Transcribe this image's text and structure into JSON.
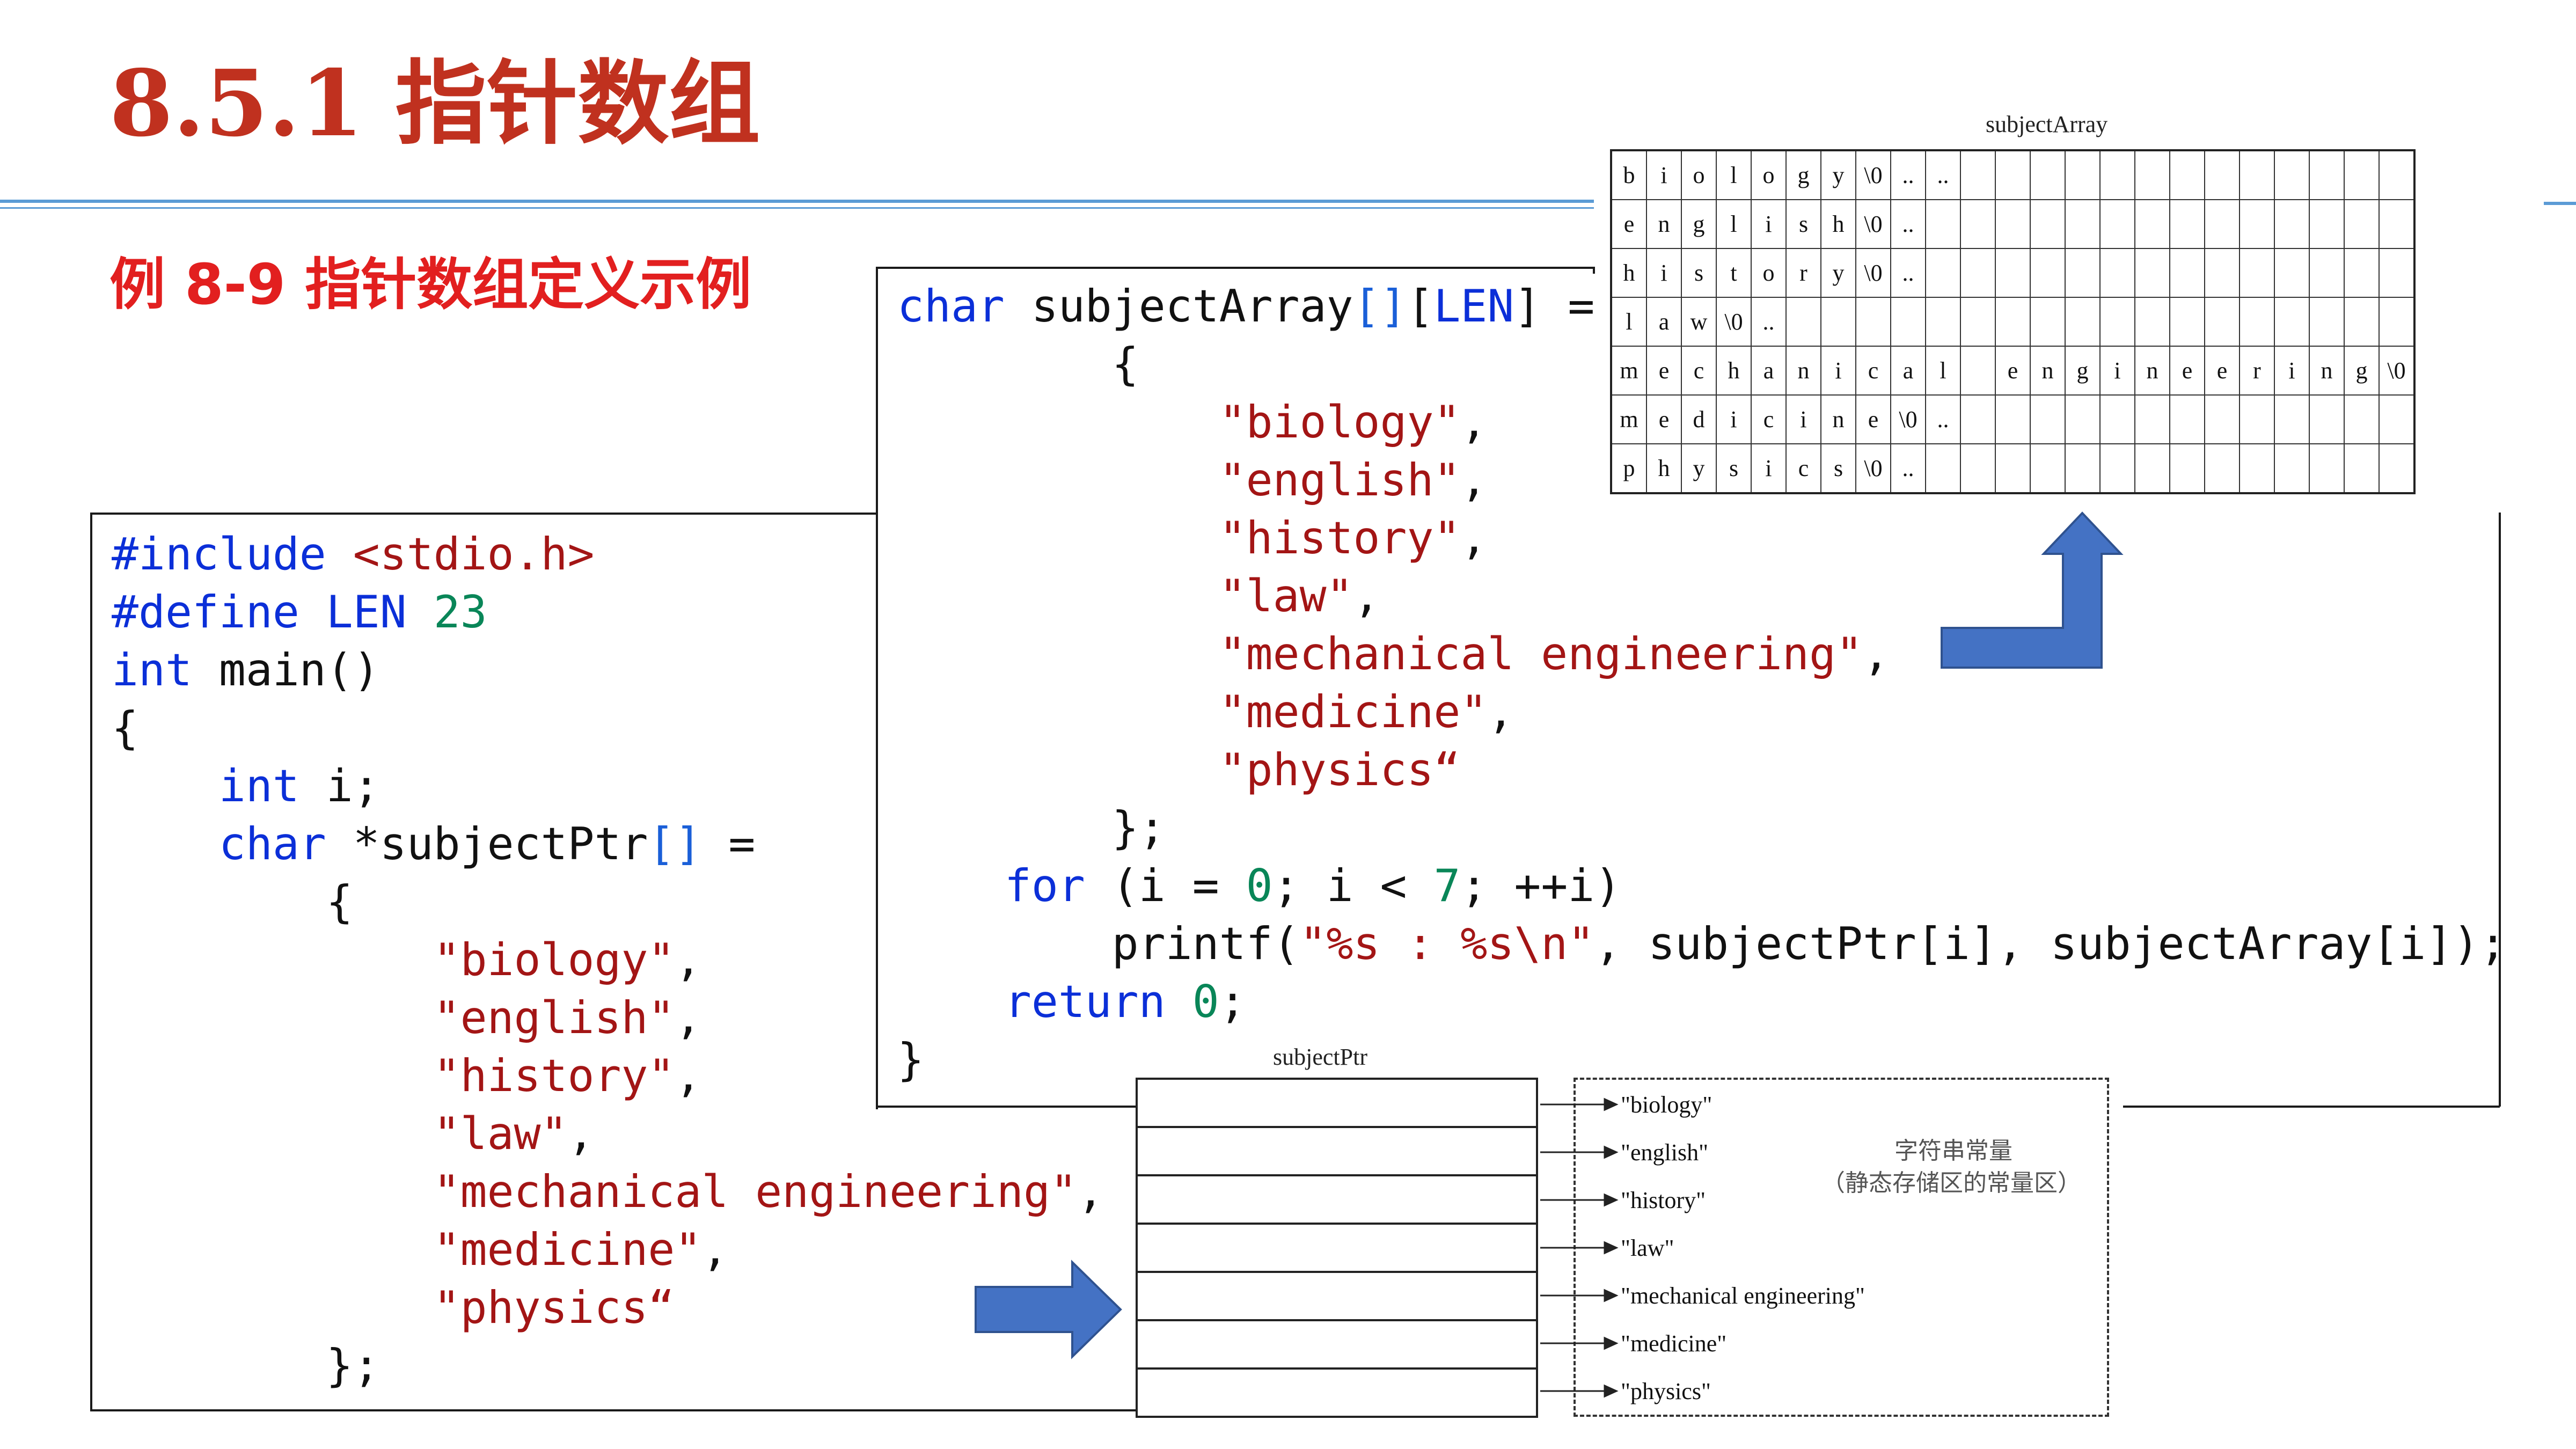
{
  "title": "8.5.1 指针数组",
  "subtitle": "例 8-9 指针数组定义示例",
  "code_left": [
    [
      {
        "t": "#include",
        "c": "kw"
      },
      {
        "t": " "
      },
      {
        "t": "<stdio.h>",
        "c": "str"
      }
    ],
    [
      {
        "t": "#define",
        "c": "kw"
      },
      {
        "t": " "
      },
      {
        "t": "LEN",
        "c": "kw"
      },
      {
        "t": " "
      },
      {
        "t": "23",
        "c": "num"
      }
    ],
    [
      {
        "t": "int",
        "c": "kw"
      },
      {
        "t": " main()"
      }
    ],
    [
      {
        "t": "{"
      }
    ],
    [
      {
        "t": "    "
      },
      {
        "t": "int",
        "c": "kw"
      },
      {
        "t": " i;"
      }
    ],
    [
      {
        "t": "    "
      },
      {
        "t": "char",
        "c": "kw"
      },
      {
        "t": " *subjectPtr"
      },
      {
        "t": "[]",
        "c": "br"
      },
      {
        "t": " ="
      }
    ],
    [
      {
        "t": "        {"
      }
    ],
    [
      {
        "t": "            "
      },
      {
        "t": "\"biology\"",
        "c": "str"
      },
      {
        "t": ","
      }
    ],
    [
      {
        "t": "            "
      },
      {
        "t": "\"english\"",
        "c": "str"
      },
      {
        "t": ","
      }
    ],
    [
      {
        "t": "            "
      },
      {
        "t": "\"history\"",
        "c": "str"
      },
      {
        "t": ","
      }
    ],
    [
      {
        "t": "            "
      },
      {
        "t": "\"law\"",
        "c": "str"
      },
      {
        "t": ","
      }
    ],
    [
      {
        "t": "            "
      },
      {
        "t": "\"mechanical engineering\"",
        "c": "str"
      },
      {
        "t": ","
      }
    ],
    [
      {
        "t": "            "
      },
      {
        "t": "\"medicine\"",
        "c": "str"
      },
      {
        "t": ","
      }
    ],
    [
      {
        "t": "            "
      },
      {
        "t": "\"physics“",
        "c": "str"
      }
    ],
    [
      {
        "t": "        };"
      }
    ]
  ],
  "code_right": [
    [
      {
        "t": "char",
        "c": "kw"
      },
      {
        "t": " subjectArray"
      },
      {
        "t": "[]",
        "c": "br"
      },
      {
        "t": "["
      },
      {
        "t": "LEN",
        "c": "kw"
      },
      {
        "t": "] ="
      }
    ],
    [
      {
        "t": "        {"
      }
    ],
    [
      {
        "t": "            "
      },
      {
        "t": "\"biology\"",
        "c": "str"
      },
      {
        "t": ","
      }
    ],
    [
      {
        "t": "            "
      },
      {
        "t": "\"english\"",
        "c": "str"
      },
      {
        "t": ","
      }
    ],
    [
      {
        "t": "            "
      },
      {
        "t": "\"history\"",
        "c": "str"
      },
      {
        "t": ","
      }
    ],
    [
      {
        "t": "            "
      },
      {
        "t": "\"law\"",
        "c": "str"
      },
      {
        "t": ","
      }
    ],
    [
      {
        "t": "            "
      },
      {
        "t": "\"mechanical engineering\"",
        "c": "str"
      },
      {
        "t": ","
      }
    ],
    [
      {
        "t": "            "
      },
      {
        "t": "\"medicine\"",
        "c": "str"
      },
      {
        "t": ","
      }
    ],
    [
      {
        "t": "            "
      },
      {
        "t": "\"physics“",
        "c": "str"
      }
    ],
    [
      {
        "t": "        };"
      }
    ],
    [
      {
        "t": "    "
      },
      {
        "t": "for",
        "c": "kw"
      },
      {
        "t": " (i = "
      },
      {
        "t": "0",
        "c": "num"
      },
      {
        "t": "; i < "
      },
      {
        "t": "7",
        "c": "num"
      },
      {
        "t": "; ++i)"
      }
    ],
    [
      {
        "t": "        printf("
      },
      {
        "t": "\"%s : %s\\n\"",
        "c": "str"
      },
      {
        "t": ", subjectPtr[i], subjectArray[i]);"
      }
    ],
    [
      {
        "t": "    "
      },
      {
        "t": "return",
        "c": "kw"
      },
      {
        "t": " "
      },
      {
        "t": "0",
        "c": "num"
      },
      {
        "t": ";"
      }
    ],
    [
      {
        "t": "}"
      }
    ]
  ],
  "subjectArray_figure": {
    "label": "subjectArray",
    "rows": [
      [
        "b",
        "i",
        "o",
        "l",
        "o",
        "g",
        "y",
        "\\0",
        "..",
        "..",
        "",
        "",
        "",
        "",
        "",
        "",
        "",
        "",
        "",
        "",
        "",
        "",
        ""
      ],
      [
        "e",
        "n",
        "g",
        "l",
        "i",
        "s",
        "h",
        "\\0",
        "..",
        "",
        "",
        "",
        "",
        "",
        "",
        "",
        "",
        "",
        "",
        "",
        "",
        "",
        ""
      ],
      [
        "h",
        "i",
        "s",
        "t",
        "o",
        "r",
        "y",
        "\\0",
        "..",
        "",
        "",
        "",
        "",
        "",
        "",
        "",
        "",
        "",
        "",
        "",
        "",
        "",
        ""
      ],
      [
        "l",
        "a",
        "w",
        "\\0",
        "..",
        "",
        "",
        "",
        "",
        "",
        "",
        "",
        "",
        "",
        "",
        "",
        "",
        "",
        "",
        "",
        "",
        "",
        ""
      ],
      [
        "m",
        "e",
        "c",
        "h",
        "a",
        "n",
        "i",
        "c",
        "a",
        "l",
        "",
        "e",
        "n",
        "g",
        "i",
        "n",
        "e",
        "e",
        "r",
        "i",
        "n",
        "g",
        "\\0"
      ],
      [
        "m",
        "e",
        "d",
        "i",
        "c",
        "i",
        "n",
        "e",
        "\\0",
        "..",
        "",
        "",
        "",
        "",
        "",
        "",
        "",
        "",
        "",
        "",
        "",
        "",
        ""
      ],
      [
        "p",
        "h",
        "y",
        "s",
        "i",
        "c",
        "s",
        "\\0",
        "..",
        "",
        "",
        "",
        "",
        "",
        "",
        "",
        "",
        "",
        "",
        "",
        "",
        "",
        ""
      ]
    ]
  },
  "subjectPtr_figure": {
    "label": "subjectPtr",
    "strings": [
      "\"biology\"",
      "\"english\"",
      "\"history\"",
      "\"law\"",
      "\"mechanical engineering\"",
      "\"medicine\"",
      "\"physics\""
    ],
    "note_line1": "字符串常量",
    "note_line2": "（静态存储区的常量区）"
  },
  "colors": {
    "title": "#c0311f",
    "subtitle": "#e21f1f",
    "keyword": "#0b2fd8",
    "string": "#a31515",
    "number": "#098658",
    "arrow": "#4472c4",
    "rule": "#5b9bd5"
  }
}
